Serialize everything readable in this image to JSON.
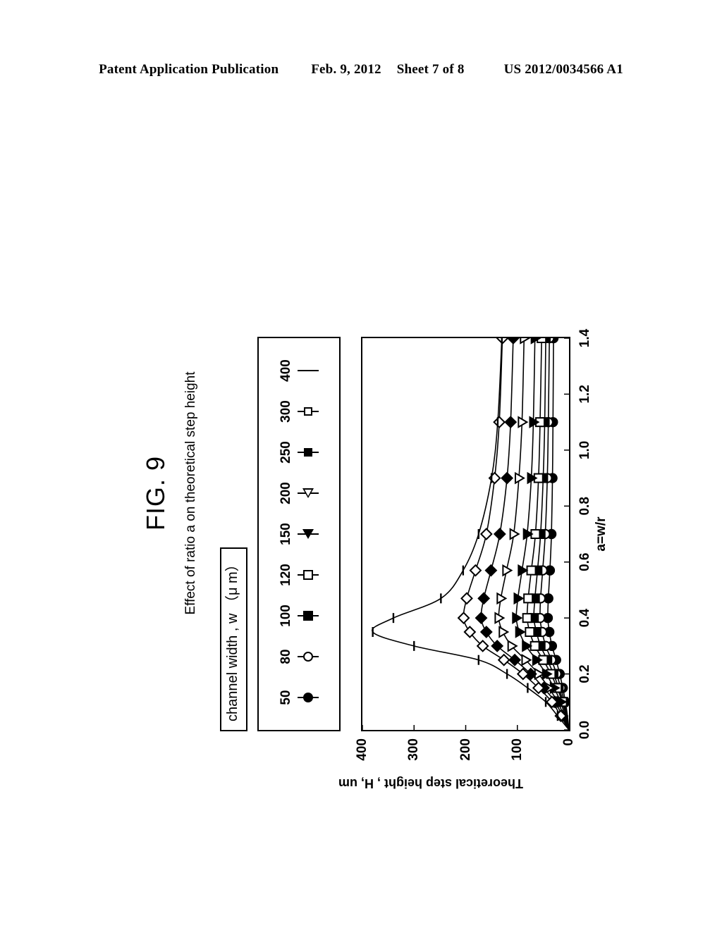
{
  "patent_header": {
    "publication": "Patent Application Publication",
    "date": "Feb. 9, 2012",
    "sheet": "Sheet 7 of 8",
    "number": "US 2012/0034566 A1"
  },
  "figure": {
    "number": "FIG. 9",
    "caption": "Effect of ratio a on theoretical step height"
  },
  "legend": {
    "title": "channel width , w （μ m）",
    "entries": [
      {
        "label": "50",
        "marker": "circle-filled"
      },
      {
        "label": "80",
        "marker": "circle-open"
      },
      {
        "label": "100",
        "marker": "square-filled"
      },
      {
        "label": "120",
        "marker": "square-open"
      },
      {
        "label": "150",
        "marker": "triangle-filled"
      },
      {
        "label": "200",
        "marker": "triangle-open"
      },
      {
        "label": "250",
        "marker": "diamond-filled"
      },
      {
        "label": "300",
        "marker": "diamond-open"
      },
      {
        "label": "400",
        "marker": "line-plain"
      }
    ]
  },
  "chart_data": {
    "type": "line",
    "title": "Effect of ratio a on theoretical step height",
    "xlabel": "a=w/r",
    "ylabel": "Theoretical step height , H, um",
    "xlim": [
      0.0,
      1.4
    ],
    "ylim": [
      0,
      400
    ],
    "xticks": [
      0.0,
      0.2,
      0.4,
      0.6,
      0.8,
      1.0,
      1.2,
      1.4
    ],
    "xtick_labels": [
      "0.0",
      "0.2",
      "0.4",
      "0.6",
      "0.8",
      "1.0",
      "1.2",
      "1.4"
    ],
    "yticks": [
      0,
      100,
      200,
      300,
      400
    ],
    "ytick_labels": [
      "0",
      "100",
      "200",
      "300",
      "400"
    ],
    "grid": false,
    "legend_position": "above-plot",
    "legend_title": "channel width , w （μ m）",
    "x": [
      0.0,
      0.05,
      0.1,
      0.15,
      0.2,
      0.25,
      0.3,
      0.35,
      0.4,
      0.47,
      0.57,
      0.7,
      0.9,
      1.1,
      1.4
    ],
    "series": [
      {
        "name": "50",
        "marker": "circle-filled",
        "values": [
          0,
          3,
          7,
          12,
          18,
          25,
          33,
          38,
          41,
          40,
          37,
          34,
          32,
          31,
          30
        ]
      },
      {
        "name": "80",
        "marker": "circle-open",
        "values": [
          0,
          4,
          9,
          16,
          24,
          34,
          45,
          52,
          56,
          55,
          51,
          46,
          42,
          40,
          38
        ]
      },
      {
        "name": "100",
        "marker": "square-filled",
        "values": [
          0,
          5,
          11,
          20,
          30,
          42,
          55,
          63,
          68,
          66,
          61,
          55,
          50,
          47,
          45
        ]
      },
      {
        "name": "120",
        "marker": "square-open",
        "values": [
          0,
          6,
          13,
          23,
          35,
          50,
          66,
          76,
          81,
          79,
          73,
          65,
          59,
          56,
          53
        ]
      },
      {
        "name": "150",
        "marker": "triangle-filled",
        "values": [
          0,
          8,
          16,
          29,
          44,
          63,
          83,
          96,
          102,
          99,
          91,
          81,
          73,
          69,
          66
        ]
      },
      {
        "name": "200",
        "marker": "triangle-open",
        "values": [
          0,
          10,
          22,
          39,
          59,
          84,
          111,
          128,
          136,
          132,
          121,
          107,
          97,
          91,
          87
        ]
      },
      {
        "name": "250",
        "marker": "diamond-filled",
        "values": [
          0,
          13,
          27,
          49,
          74,
          105,
          139,
          160,
          170,
          165,
          151,
          134,
          120,
          113,
          108
        ]
      },
      {
        "name": "300",
        "marker": "diamond-open",
        "values": [
          0,
          16,
          33,
          59,
          89,
          126,
          167,
          192,
          204,
          198,
          181,
          160,
          144,
          135,
          129
        ]
      },
      {
        "name": "400",
        "marker": "line-plain",
        "values": [
          0,
          22,
          45,
          80,
          120,
          175,
          300,
          380,
          340,
          248,
          205,
          175,
          150,
          138,
          130
        ]
      }
    ]
  },
  "axes": {
    "x_title": "a=w/r",
    "y_title": "Theoretical step height , H, um"
  }
}
